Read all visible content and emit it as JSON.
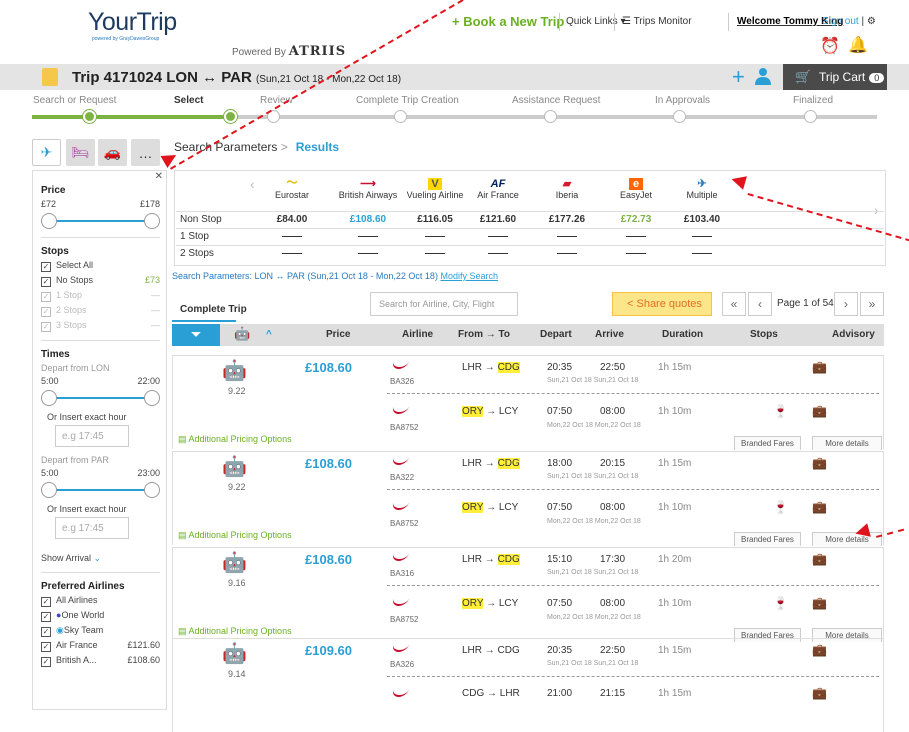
{
  "brand": {
    "logo": "YourTrip",
    "logo_sub": "powered by GrayDawesGroup",
    "powered_by": "Powered By",
    "powered_brand": "ATRIIS"
  },
  "topnav": {
    "book": "+ Book a New Trip",
    "quick_links": "Quick Links ▾",
    "trips_monitor": "Trips Monitor",
    "welcome": "Welcome Tommy King",
    "sign_out": "Sign out",
    "sep": "|"
  },
  "trip": {
    "title": "Trip 4171024 LON ↔ PAR",
    "dates": "(Sun,21 Oct 18 - Mon,22 Oct 18)",
    "cart_label": "Trip Cart",
    "cart_count": "0"
  },
  "steps": [
    "Search or Request",
    "Select",
    "Review",
    "Complete Trip Creation",
    "Assistance Request",
    "In Approvals",
    "Finalized"
  ],
  "crumb": {
    "params": "Search Parameters",
    "sep": ">",
    "results": "Results"
  },
  "sidebar": {
    "price_h": "Price",
    "price_min": "£72",
    "price_max": "£178",
    "stops_h": "Stops",
    "stops": [
      {
        "label": "Select All",
        "val": ""
      },
      {
        "label": "No Stops",
        "val": "£73"
      },
      {
        "label": "1 Stop",
        "val": "—"
      },
      {
        "label": "2 Stops",
        "val": "—"
      },
      {
        "label": "3 Stops",
        "val": "—"
      }
    ],
    "times_h": "Times",
    "dep_lon": "Depart from LON",
    "lon_min": "5:00",
    "lon_max": "22:00",
    "exact": "Or Insert exact hour",
    "exact_ph": "e.g 17:45",
    "dep_par": "Depart from PAR",
    "par_min": "5:00",
    "par_max": "23:00",
    "show_arrival": "Show Arrival",
    "pref_h": "Preferred Airlines",
    "airlines": [
      {
        "label": "All Airlines",
        "val": ""
      },
      {
        "label": "One World",
        "val": ""
      },
      {
        "label": "Sky Team",
        "val": ""
      },
      {
        "label": "Air France",
        "val": "£121.60"
      },
      {
        "label": "British A...",
        "val": "£108.60"
      }
    ]
  },
  "airline_table": {
    "airlines": [
      "Eurostar",
      "British Airways",
      "Vueling Airline",
      "Air France",
      "Iberia",
      "EasyJet",
      "Multiple"
    ],
    "rows": [
      {
        "label": "Non Stop",
        "vals": [
          "£84.00",
          "£108.60",
          "£116.05",
          "£121.60",
          "£177.26",
          "£72.73",
          "£103.40"
        ]
      },
      {
        "label": "1 Stop",
        "vals": [
          "——",
          "——",
          "——",
          "——",
          "——",
          "——",
          "——"
        ]
      },
      {
        "label": "2 Stops",
        "vals": [
          "——",
          "——",
          "——",
          "——",
          "——",
          "——",
          "——"
        ]
      }
    ]
  },
  "search_params": {
    "text": "Search Parameters: LON ↔ PAR (Sun,21 Oct 18 - Mon,22 Oct 18)",
    "modify": "Modify Search"
  },
  "results": {
    "complete_trip": "Complete Trip",
    "search_ph": "Search for Airline, City, Flight",
    "share": "Share quotes",
    "page": "Page 1 of 54",
    "headers": [
      "Price",
      "Airline",
      "From → To",
      "Depart",
      "Arrive",
      "Duration",
      "Stops",
      "Advisory"
    ],
    "apo": "Additional Pricing Options",
    "branded": "Branded Fares",
    "more": "More details",
    "items": [
      {
        "score": "9.22",
        "price": "£108.60",
        "out": {
          "flight": "BA326",
          "route_a": "LHR → ",
          "route_b": "CDG",
          "dep": "20:35",
          "arr": "22:50",
          "date": "Sun,21 Oct 18  Sun,21 Oct 18",
          "dur": "1h 15m"
        },
        "ret": {
          "flight": "BA8752",
          "route_a": "ORY",
          "route_b": " → LCY",
          "dep": "07:50",
          "arr": "08:00",
          "date": "Mon,22 Oct 18  Mon,22 Oct 18",
          "dur": "1h 10m"
        }
      },
      {
        "score": "9.22",
        "price": "£108.60",
        "out": {
          "flight": "BA322",
          "route_a": "LHR → ",
          "route_b": "CDG",
          "dep": "18:00",
          "arr": "20:15",
          "date": "Sun,21 Oct 18  Sun,21 Oct 18",
          "dur": "1h 15m"
        },
        "ret": {
          "flight": "BA8752",
          "route_a": "ORY",
          "route_b": " → LCY",
          "dep": "07:50",
          "arr": "08:00",
          "date": "Mon,22 Oct 18  Mon,22 Oct 18",
          "dur": "1h 10m"
        }
      },
      {
        "score": "9.16",
        "price": "£108.60",
        "out": {
          "flight": "BA316",
          "route_a": "LHR → ",
          "route_b": "CDG",
          "dep": "15:10",
          "arr": "17:30",
          "date": "Sun,21 Oct 18  Sun,21 Oct 18",
          "dur": "1h 20m"
        },
        "ret": {
          "flight": "BA8752",
          "route_a": "ORY",
          "route_b": " → LCY",
          "dep": "07:50",
          "arr": "08:00",
          "date": "Mon,22 Oct 18  Mon,22 Oct 18",
          "dur": "1h 10m"
        }
      },
      {
        "score": "9.14",
        "price": "£109.60",
        "out": {
          "flight": "BA326",
          "route_a": "LHR → CDG",
          "route_b": "",
          "dep": "20:35",
          "arr": "22:50",
          "date": "Sun,21 Oct 18  Sun,21 Oct 18",
          "dur": "1h 15m"
        },
        "ret": {
          "flight": "",
          "route_a": "CDG → LHR",
          "route_b": "",
          "dep": "21:00",
          "arr": "21:15",
          "date": "",
          "dur": "1h 15m"
        }
      }
    ]
  }
}
